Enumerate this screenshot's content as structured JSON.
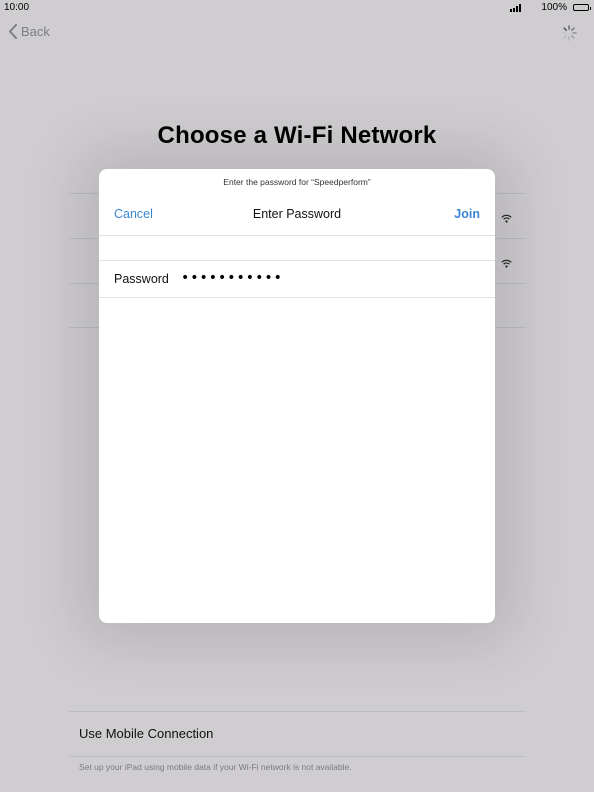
{
  "status_bar": {
    "time": "10:00",
    "battery": "100%"
  },
  "navigation": {
    "back_label": "Back"
  },
  "page": {
    "title": "Choose a Wi-Fi Network"
  },
  "mobile": {
    "label": "Use Mobile Connection",
    "footnote": "Set up your iPad using mobile data if your Wi-Fi network is not available."
  },
  "modal": {
    "prompt": "Enter the password for “Speedperform”",
    "cancel_label": "Cancel",
    "title": "Enter Password",
    "join_label": "Join",
    "password_label": "Password",
    "password_value": "abcdefghijk"
  },
  "icons": {
    "back": "chevron-left-icon",
    "loading": "spinner-icon",
    "wifi": "wifi-icon",
    "signal": "signal-icon",
    "battery": "battery-icon"
  },
  "colors": {
    "accent": "#3a86d1",
    "background": "#cfcdd0"
  }
}
